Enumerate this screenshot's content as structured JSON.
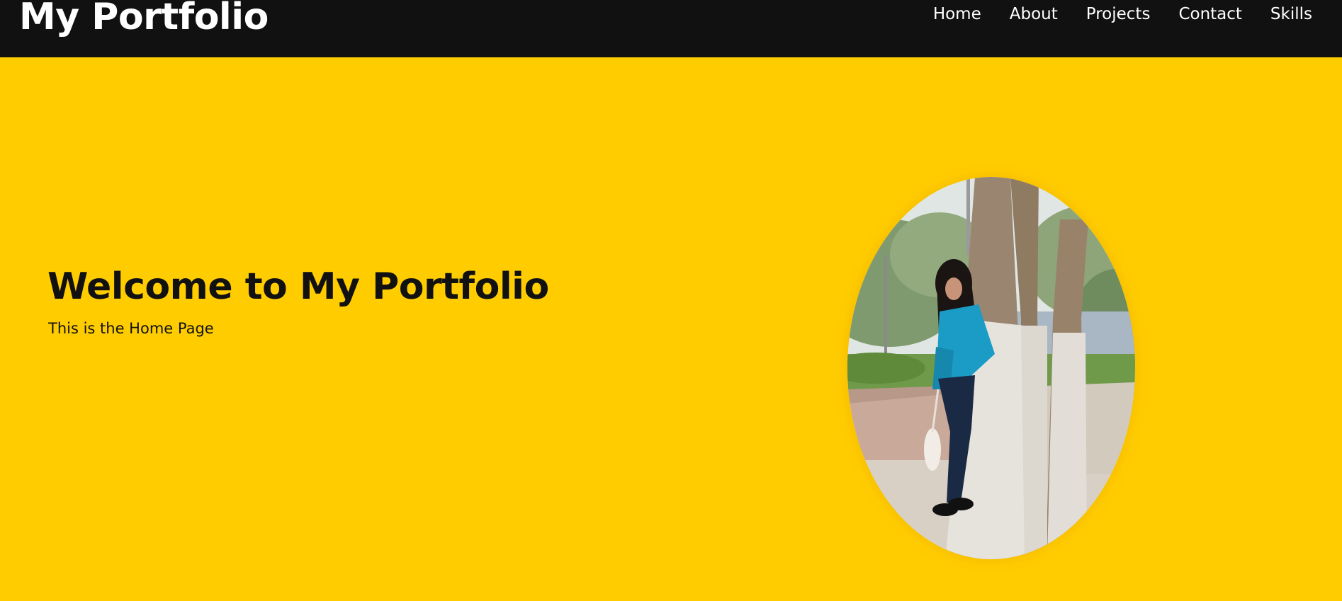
{
  "header": {
    "logo": "My Portfolio",
    "nav": [
      {
        "label": "Home"
      },
      {
        "label": "About"
      },
      {
        "label": "Projects"
      },
      {
        "label": "Contact"
      },
      {
        "label": "Skills"
      }
    ]
  },
  "hero": {
    "title": "Welcome to My Portfolio",
    "subtitle": "This is the Home Page",
    "photo_icon": "profile-photo"
  },
  "colors": {
    "navbar": "#111111",
    "hero_background": "#ffcc00",
    "text_light": "#ffffff",
    "text_dark": "#111111"
  }
}
